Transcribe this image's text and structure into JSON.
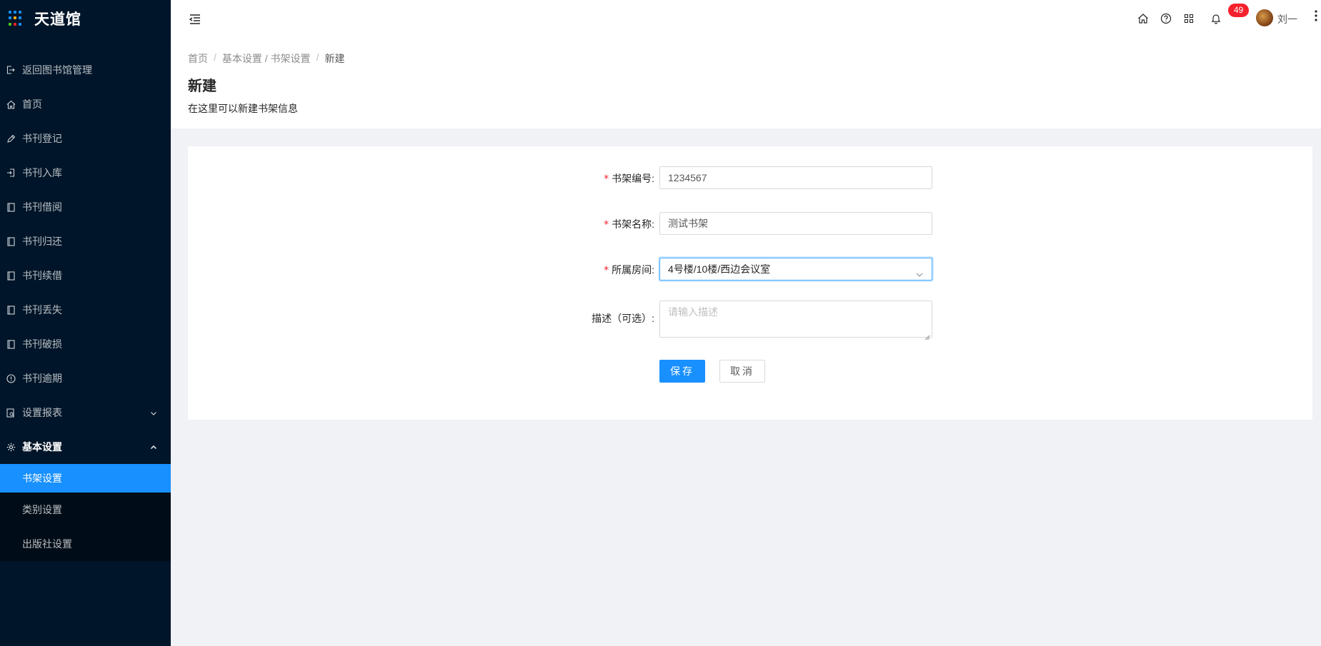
{
  "app": {
    "logo_text": "天道馆",
    "logo_colors": [
      "#1890ff",
      "#1890ff",
      "#1890ff",
      "#1890ff",
      "#faad14",
      "#1890ff",
      "#52c41a",
      "#f5222d",
      "#1890ff"
    ]
  },
  "sidebar": {
    "items": [
      {
        "label": "返回图书馆管理",
        "icon": "logout-icon"
      },
      {
        "label": "首页",
        "icon": "home-icon"
      },
      {
        "label": "书刊登记",
        "icon": "pen-icon"
      },
      {
        "label": "书刊入库",
        "icon": "login-icon"
      },
      {
        "label": "书刊借阅",
        "icon": "book-icon"
      },
      {
        "label": "书刊归还",
        "icon": "book-icon"
      },
      {
        "label": "书刊续借",
        "icon": "book-icon"
      },
      {
        "label": "书刊丢失",
        "icon": "book-icon"
      },
      {
        "label": "书刊破损",
        "icon": "book-icon"
      },
      {
        "label": "书刊逾期",
        "icon": "info-circle-icon"
      },
      {
        "label": "设置报表",
        "icon": "report-icon"
      },
      {
        "label": "基本设置",
        "icon": "gear-icon"
      }
    ],
    "submenu": [
      {
        "label": "书架设置"
      },
      {
        "label": "类别设置"
      },
      {
        "label": "出版社设置"
      }
    ]
  },
  "header": {
    "notification_count": "49",
    "user_name": "刘一",
    "icons": [
      "home-icon",
      "question-icon",
      "apps-icon",
      "bell-icon"
    ]
  },
  "page": {
    "breadcrumb": [
      "首页",
      "基本设置 / 书架设置",
      "新建"
    ],
    "title": "新建",
    "description": "在这里可以新建书架信息"
  },
  "form": {
    "shelf_code_label": "书架编号:",
    "shelf_code_value": "1234567",
    "shelf_name_label": "书架名称:",
    "shelf_name_value": "测试书架",
    "room_label": "所属房间:",
    "room_value": "4号楼/10楼/西边会议室",
    "desc_label": "描述（可选）:",
    "desc_placeholder": "请输入描述",
    "required_mark": "*",
    "save_label": "保存",
    "cancel_label": "取消"
  }
}
